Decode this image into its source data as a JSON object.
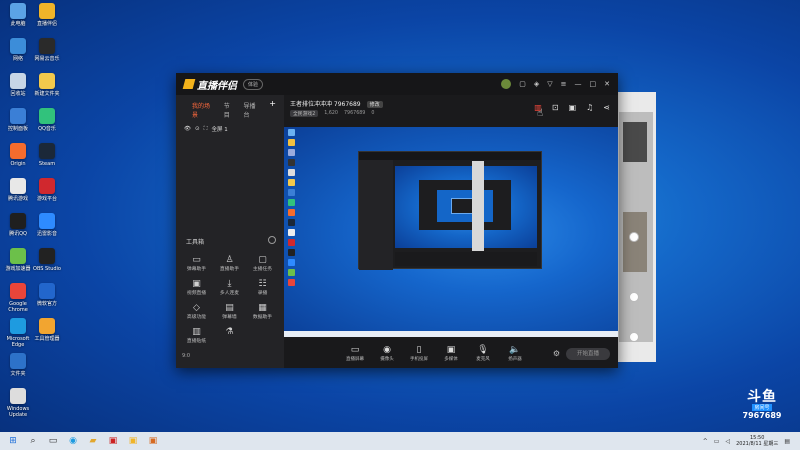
{
  "desktop": {
    "icons": [
      {
        "label": "此电脑",
        "color": "#5ba3e6"
      },
      {
        "label": "直播伴侣",
        "color": "#f0b429"
      },
      {
        "label": "网络",
        "color": "#3c8dd9"
      },
      {
        "label": "网易云音乐",
        "color": "#2a2a2a"
      },
      {
        "label": "回收站",
        "color": "#c7d6e6"
      },
      {
        "label": "新建文件夹",
        "color": "#f2c94c"
      },
      {
        "label": "控制面板",
        "color": "#3b7fd6"
      },
      {
        "label": "QQ音乐",
        "color": "#31c27c"
      },
      {
        "label": "Origin",
        "color": "#f56c2d"
      },
      {
        "label": "Steam",
        "color": "#1b2838"
      },
      {
        "label": "腾讯游戏",
        "color": "#e8e8e8"
      },
      {
        "label": "游戏平台",
        "color": "#d0282e"
      },
      {
        "label": "腾讯QQ",
        "color": "#1f1f1f"
      },
      {
        "label": "迅雷影音",
        "color": "#2e8bff"
      },
      {
        "label": "游戏加速器",
        "color": "#6cc04a"
      },
      {
        "label": "OBS Studio",
        "color": "#222"
      },
      {
        "label": "Google Chrome",
        "color": "#e9453a"
      },
      {
        "label": "微软官方",
        "color": "#2266cc"
      },
      {
        "label": "Microsoft Edge",
        "color": "#1e9be0"
      },
      {
        "label": "工具管理器",
        "color": "#f2a530"
      },
      {
        "label": "文件夹",
        "color": "#2d72c9"
      },
      {
        "label": "Windows Update",
        "color": "#dddddd"
      }
    ]
  },
  "app": {
    "logo_text": "直播伴侣",
    "version_badge": "体验",
    "sidebar": {
      "tabs": [
        "我的场景",
        "节目",
        "导播台"
      ],
      "scene_name": "全屏 1",
      "tools_title": "工具箱",
      "tools": [
        {
          "icon": "▭",
          "label": "弹幕助手"
        },
        {
          "icon": "♙",
          "label": "直播助手"
        },
        {
          "icon": "▢",
          "label": "主播任务"
        },
        {
          "icon": "▣",
          "label": "视频直播"
        },
        {
          "icon": "⤓",
          "label": "多人连麦"
        },
        {
          "icon": "☷",
          "label": "录播"
        },
        {
          "icon": "◇",
          "label": "高级功能"
        },
        {
          "icon": "▤",
          "label": "弹幕墙"
        },
        {
          "icon": "▦",
          "label": "数据助手"
        },
        {
          "icon": "▥",
          "label": "直播贴纸"
        },
        {
          "icon": "⚗",
          "label": ""
        }
      ],
      "footer": "9:0"
    },
    "main": {
      "room_title": "王者排位冲冲冲 7967689",
      "copy_label": "修改",
      "meta_tag": "全民游戏2",
      "meta_views": "1,620",
      "meta_id": "7967689",
      "meta_hot": "0",
      "bottom_buttons": [
        {
          "icon": "▭",
          "label": "直播屏幕"
        },
        {
          "icon": "◉",
          "label": "摄像头"
        },
        {
          "icon": "▯",
          "label": "手机投屏"
        },
        {
          "icon": "▣",
          "label": "多媒体"
        },
        {
          "icon": "🎙",
          "label": "麦克风"
        },
        {
          "icon": "🔈",
          "label": "扬声器"
        }
      ],
      "live_button": "开始直播"
    }
  },
  "watermark": {
    "brand": "斗鱼",
    "tag": "房间号",
    "room": "7967689"
  },
  "taskbar": {
    "time": "15:50",
    "date": "2021/8/11 星期三"
  }
}
